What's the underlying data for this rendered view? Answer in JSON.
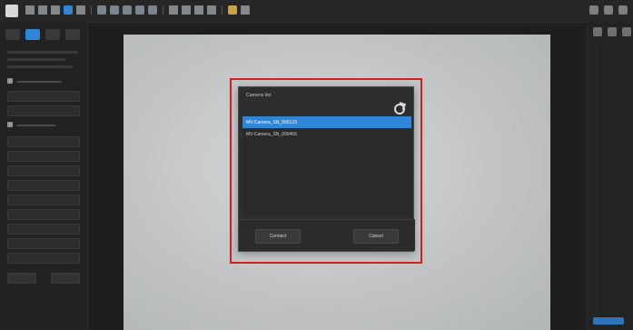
{
  "dialog": {
    "title": "Camera list",
    "items": [
      {
        "label": "MV-Camera_SN_000123",
        "selected": true
      },
      {
        "label": "MV-Camera_SN_000456",
        "selected": false
      }
    ],
    "buttons": {
      "connect": "Connect",
      "cancel": "Cancel"
    }
  },
  "colors": {
    "highlight_border": "#d82020",
    "selection": "#2f85d6"
  },
  "icons": {
    "refresh": "refresh-icon"
  }
}
